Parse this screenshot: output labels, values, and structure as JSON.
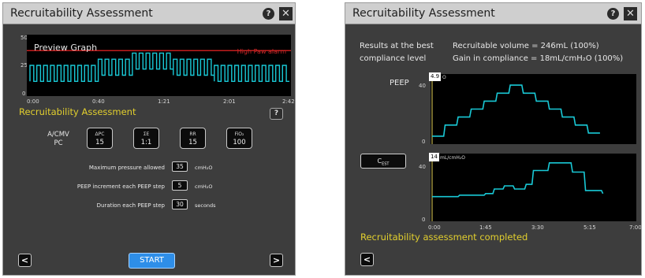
{
  "left_panel": {
    "title": "Recruitability Assessment",
    "help_glyph": "?",
    "close_glyph": "✕",
    "preview_graph": {
      "title": "Preview Graph",
      "alarm_label": "High Paw alarm",
      "y_ticks": [
        "50",
        "25",
        "0"
      ],
      "x_ticks": [
        "0:00",
        "0:40",
        "1:21",
        "2:01",
        "2:42"
      ]
    },
    "section_title": "Recruitability Assessment",
    "section_help": "?",
    "mode": {
      "line1": "A/CMV",
      "line2": "PC"
    },
    "params": [
      {
        "name": "ΔPC",
        "value": "15"
      },
      {
        "name": "ΣE",
        "value": "1:1"
      },
      {
        "name": "RR",
        "value": "15"
      },
      {
        "name": "FiO₂",
        "value": "100"
      }
    ],
    "settings": [
      {
        "label": "Maximum pressure allowed",
        "value": "35",
        "unit": "cmH₂O"
      },
      {
        "label": "PEEP increment each PEEP step",
        "value": "5",
        "unit": "cmH₂O"
      },
      {
        "label": "Duration each PEEP step",
        "value": "30",
        "unit": "seconds"
      }
    ],
    "back_glyph": "<",
    "next_glyph": ">",
    "start_label": "START"
  },
  "right_panel": {
    "title": "Recruitability Assessment",
    "help_glyph": "?",
    "close_glyph": "✕",
    "results_label_line1": "Results at the best",
    "results_label_line2": "compliance level",
    "recruitable_volume": "Recruitable volume = 246mL (100%)",
    "gain_in_compliance": "Gain in compliance = 18mL/cmH₂O (100%)",
    "peep_label": "PEEP",
    "peep_value": "4.9",
    "peep_unit": "O",
    "peep_y_ticks": [
      "40",
      "0"
    ],
    "cest_label": "C",
    "cest_sub": "EST",
    "cest_value": "14",
    "cest_unit": "mL/cmH₂O",
    "cest_y_ticks": [
      "40",
      "0"
    ],
    "x_ticks": [
      "0:00",
      "1:45",
      "3:30",
      "5:15",
      "7:00"
    ],
    "status_message": "Recruitability assessment completed",
    "back_glyph": "<"
  },
  "colors": {
    "panel_bg": "#3d3d3d",
    "titlebar_bg": "#cfcfcf",
    "waveform": "#19c9d6",
    "alarm_line": "#c11d1d",
    "status_yellow": "#e2cf2e",
    "start_blue": "#2e8ee8"
  },
  "chart_data": [
    {
      "type": "line",
      "name": "preview",
      "title": "Preview Graph",
      "x_ticks": [
        "0:00",
        "0:40",
        "1:21",
        "2:01",
        "2:42"
      ],
      "ylim": [
        0,
        50
      ],
      "alarm_level": 37,
      "steps": [
        {
          "low": 12,
          "high": 25,
          "cycles": 10
        },
        {
          "low": 17,
          "high": 30,
          "cycles": 5
        },
        {
          "low": 22,
          "high": 35,
          "cycles": 6
        },
        {
          "low": 17,
          "high": 30,
          "cycles": 6
        },
        {
          "low": 12,
          "high": 25,
          "cycles": 11
        }
      ]
    },
    {
      "type": "line",
      "name": "peep_trend",
      "series": [
        {
          "name": "PEEP",
          "values": [
            3,
            3,
            10,
            10,
            15,
            15,
            20,
            20,
            25,
            25,
            30,
            30,
            35,
            35,
            30,
            30,
            25,
            25,
            20,
            20,
            15,
            15,
            10,
            10,
            5,
            5
          ]
        }
      ],
      "x": [
        0,
        0.4,
        0.45,
        0.85,
        0.9,
        1.3,
        1.35,
        1.75,
        1.8,
        2.2,
        2.25,
        2.65,
        2.7,
        3.1,
        3.15,
        3.55,
        3.6,
        4.0,
        4.05,
        4.45,
        4.5,
        4.9,
        4.95,
        5.35,
        5.4,
        5.8
      ],
      "ylim": [
        0,
        40
      ],
      "xlim": [
        0,
        7
      ]
    },
    {
      "type": "line",
      "name": "cest_trend",
      "series": [
        {
          "name": "CEST",
          "values": [
            14,
            14,
            15,
            15,
            16,
            16,
            19,
            19,
            21,
            21,
            19,
            19,
            22,
            22,
            31,
            31,
            36,
            36,
            30,
            30,
            18,
            18,
            16
          ]
        }
      ],
      "x": [
        0,
        0.9,
        0.95,
        1.8,
        1.85,
        2.1,
        2.15,
        2.45,
        2.5,
        2.8,
        2.85,
        3.2,
        3.25,
        3.45,
        3.5,
        4.0,
        4.05,
        4.8,
        4.85,
        5.25,
        5.3,
        5.85,
        5.9
      ],
      "ylim": [
        0,
        40
      ],
      "xlim": [
        0,
        7
      ]
    }
  ]
}
